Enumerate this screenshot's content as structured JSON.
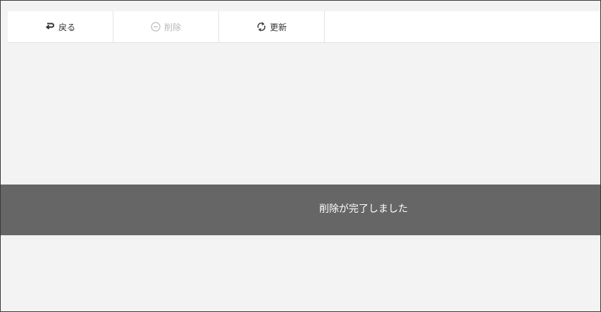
{
  "toolbar": {
    "back": {
      "label": "戻る",
      "icon": "return-arrow-icon",
      "color": "#333333"
    },
    "delete": {
      "label": "削除",
      "icon": "minus-circle-icon",
      "color": "#b8b8b8",
      "disabled": true
    },
    "refresh": {
      "label": "更新",
      "icon": "refresh-icon",
      "color": "#333333"
    }
  },
  "toast": {
    "message": "削除が完了しました",
    "background": "#666666",
    "text_color": "#ffffff"
  },
  "page": {
    "background": "#f3f3f3"
  }
}
